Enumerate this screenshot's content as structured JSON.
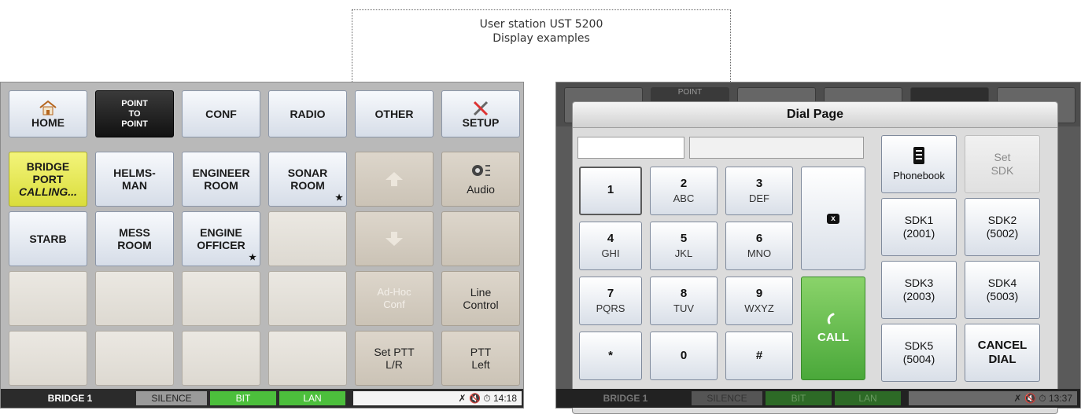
{
  "caption": {
    "line1": "User station UST 5200",
    "line2": "Display examples"
  },
  "left": {
    "top_buttons": [
      {
        "label": "HOME",
        "icon": "home-icon"
      },
      {
        "label": "POINT\nTO\nPOINT",
        "active": true
      },
      {
        "label": "CONF"
      },
      {
        "label": "RADIO"
      },
      {
        "label": "OTHER"
      },
      {
        "label": "SETUP",
        "icon": "wrench-screwdriver-icon"
      }
    ],
    "tiles": {
      "bridge_port": {
        "line1": "BRIDGE",
        "line2": "PORT",
        "line3": "CALLING..."
      },
      "helmsman": {
        "line1": "HELMS-",
        "line2": "MAN"
      },
      "engineer_room": {
        "line1": "ENGINEER",
        "line2": "ROOM"
      },
      "sonar_room": {
        "line1": "SONAR",
        "line2": "ROOM"
      },
      "audio": {
        "label": "Audio",
        "icon": "audio-icon"
      },
      "starb": {
        "label": "STARB"
      },
      "mess_room": {
        "line1": "MESS",
        "line2": "ROOM"
      },
      "engine_officer": {
        "line1": "ENGINE",
        "line2": "OFFICER"
      },
      "adhoc": {
        "line1": "Ad-Hoc",
        "line2": "Conf"
      },
      "line_control": {
        "line1": "Line",
        "line2": "Control"
      },
      "set_ptt": {
        "line1": "Set PTT",
        "line2": "L/R"
      },
      "ptt_left": {
        "line1": "PTT",
        "line2": "Left"
      }
    },
    "status": {
      "station": "BRIDGE 1",
      "silence": "SILENCE",
      "bit": "BIT",
      "lan": "LAN",
      "time": "14:18"
    }
  },
  "right": {
    "bg_labels": {
      "point": "POINT"
    },
    "dialog_title": "Dial Page",
    "keys": [
      {
        "digit": "1",
        "letters": ""
      },
      {
        "digit": "2",
        "letters": "ABC"
      },
      {
        "digit": "3",
        "letters": "DEF"
      },
      {
        "digit": "4",
        "letters": "GHI"
      },
      {
        "digit": "5",
        "letters": "JKL"
      },
      {
        "digit": "6",
        "letters": "MNO"
      },
      {
        "digit": "7",
        "letters": "PQRS"
      },
      {
        "digit": "8",
        "letters": "TUV"
      },
      {
        "digit": "9",
        "letters": "WXYZ"
      },
      {
        "digit": "*",
        "letters": ""
      },
      {
        "digit": "0",
        "letters": ""
      },
      {
        "digit": "#",
        "letters": ""
      }
    ],
    "backspace_label": "x",
    "call_label": "CALL",
    "phonebook": "Phonebook",
    "set_sdk": {
      "line1": "Set",
      "line2": "SDK"
    },
    "sdk": [
      {
        "line1": "SDK1",
        "line2": "(2001)"
      },
      {
        "line1": "SDK2",
        "line2": "(5002)"
      },
      {
        "line1": "SDK3",
        "line2": "(2003)"
      },
      {
        "line1": "SDK4",
        "line2": "(5003)"
      },
      {
        "line1": "SDK5",
        "line2": "(5004)"
      }
    ],
    "cancel": {
      "line1": "CANCEL",
      "line2": "DIAL"
    },
    "status": {
      "station": "BRIDGE 1",
      "silence": "SILENCE",
      "bit": "BIT",
      "lan": "LAN",
      "time": "13:37"
    }
  }
}
